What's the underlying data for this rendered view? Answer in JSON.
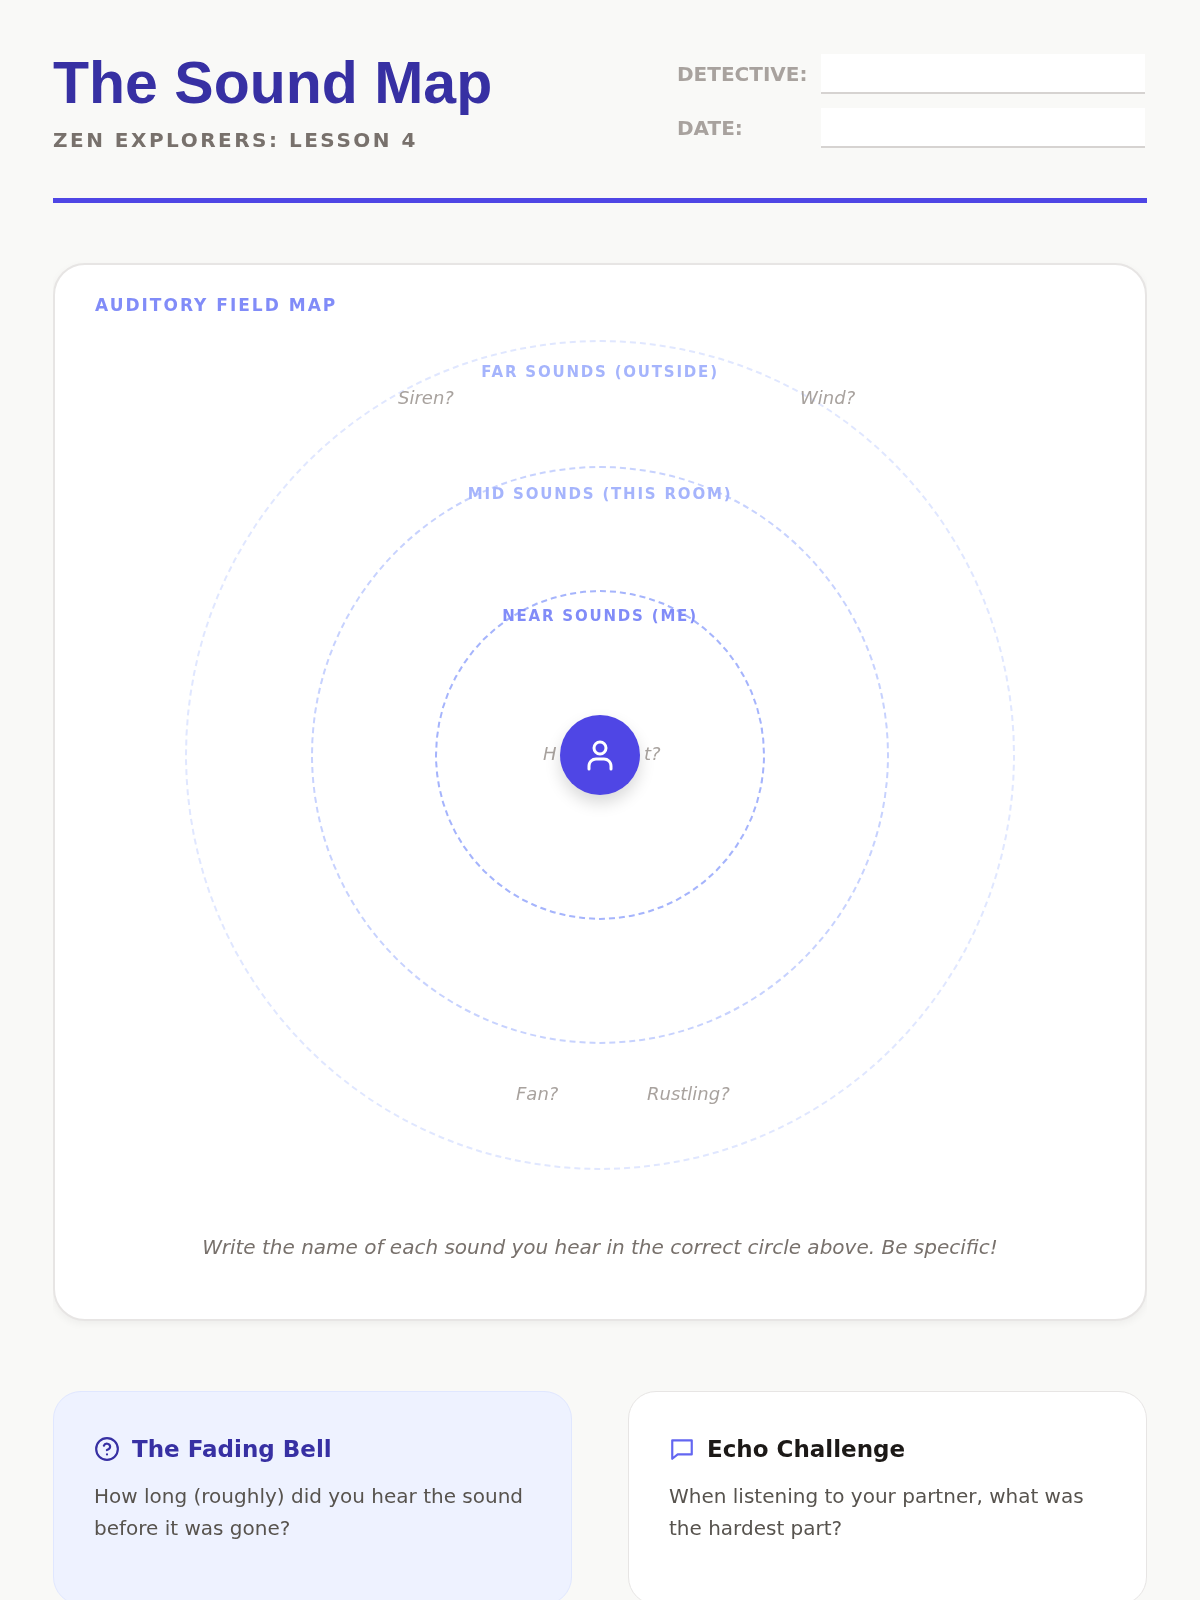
{
  "header": {
    "title": "The Sound Map",
    "subtitle": "ZEN EXPLORERS: LESSON 4",
    "fields": [
      {
        "label": "DETECTIVE:"
      },
      {
        "label": "DATE:"
      }
    ]
  },
  "map": {
    "heading": "AUDITORY FIELD MAP",
    "zones": [
      {
        "label": "FAR SOUNDS (OUTSIDE)"
      },
      {
        "label": "MID SOUNDS (THIS ROOM)"
      },
      {
        "label": "NEAR SOUNDS (ME)"
      }
    ],
    "hints": [
      {
        "text": "Siren?"
      },
      {
        "text": "Wind?"
      },
      {
        "text": "Fan?"
      },
      {
        "text": "Rustling?"
      }
    ],
    "center_hint": {
      "left": "H",
      "right": "t?"
    },
    "instruction": "Write the name of each sound you hear in the correct circle above. Be specific!"
  },
  "cards": [
    {
      "kind": "question",
      "title": "The Fading Bell",
      "text": "How long (roughly) did you hear the sound before it was gone?"
    },
    {
      "kind": "chat",
      "title": "Echo Challenge",
      "text": "When listening to your partner, what was the hardest part?"
    }
  ]
}
